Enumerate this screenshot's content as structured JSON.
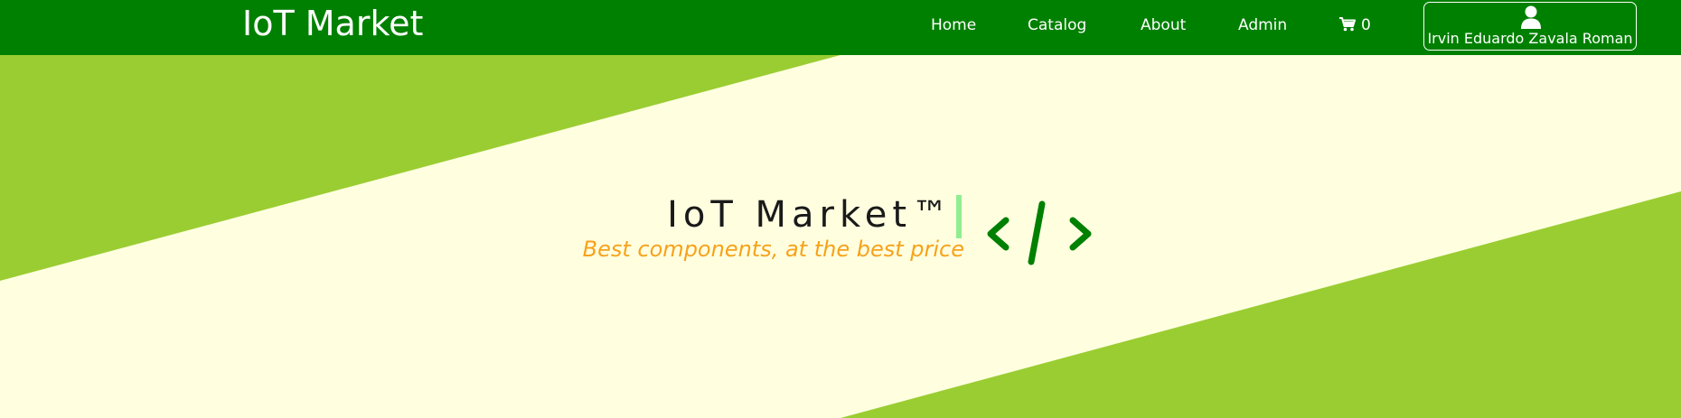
{
  "navbar": {
    "brand": "IoT Market",
    "links": [
      {
        "label": "Home"
      },
      {
        "label": "Catalog"
      },
      {
        "label": "About"
      },
      {
        "label": "Admin"
      }
    ],
    "cart_count": "0",
    "cart_icon": "shopping-cart-icon",
    "user_icon": "user-icon",
    "user_name": "Irvin Eduardo Zavala Roman"
  },
  "hero": {
    "title": "IoT Market™",
    "subtitle": "Best components, at the best price",
    "code_icon": "code-icon"
  },
  "colors": {
    "navbar": "#008000",
    "accent_green": "#9acd32",
    "background": "#ffffe0",
    "subtitle": "#f7a21b",
    "cursor": "#90ee90"
  }
}
